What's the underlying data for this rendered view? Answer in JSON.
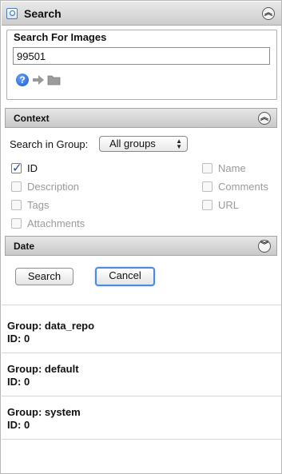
{
  "header": {
    "title": "Search",
    "collapse_icon": "double-chevron-up-icon"
  },
  "search_box": {
    "title": "Search For Images",
    "query_value": "99501",
    "icons": [
      "help-icon",
      "arrow-right-icon",
      "folder-icon"
    ],
    "help_glyph": "?"
  },
  "context": {
    "title": "Context",
    "collapse_icon": "double-chevron-up-icon",
    "group_label": "Search in Group:",
    "group_selected": "All groups",
    "fields": [
      {
        "label": "ID",
        "checked": true,
        "enabled": true
      },
      {
        "label": "Name",
        "checked": false,
        "enabled": false
      },
      {
        "label": "Description",
        "checked": false,
        "enabled": false
      },
      {
        "label": "Comments",
        "checked": false,
        "enabled": false
      },
      {
        "label": "Tags",
        "checked": false,
        "enabled": false
      },
      {
        "label": "URL",
        "checked": false,
        "enabled": false
      },
      {
        "label": "Attachments",
        "checked": false,
        "enabled": false
      }
    ]
  },
  "date": {
    "title": "Date",
    "expand_icon": "double-chevron-down-icon"
  },
  "actions": {
    "search_label": "Search",
    "cancel_label": "Cancel"
  },
  "results": [
    {
      "group": "Group: data_repo",
      "id": "ID: 0"
    },
    {
      "group": "Group: default",
      "id": "ID: 0"
    },
    {
      "group": "Group: system",
      "id": "ID: 0"
    }
  ],
  "colors": {
    "accent": "#4c8ae0",
    "help": "#1a56c8",
    "disabled_text": "#9a9a9a"
  }
}
